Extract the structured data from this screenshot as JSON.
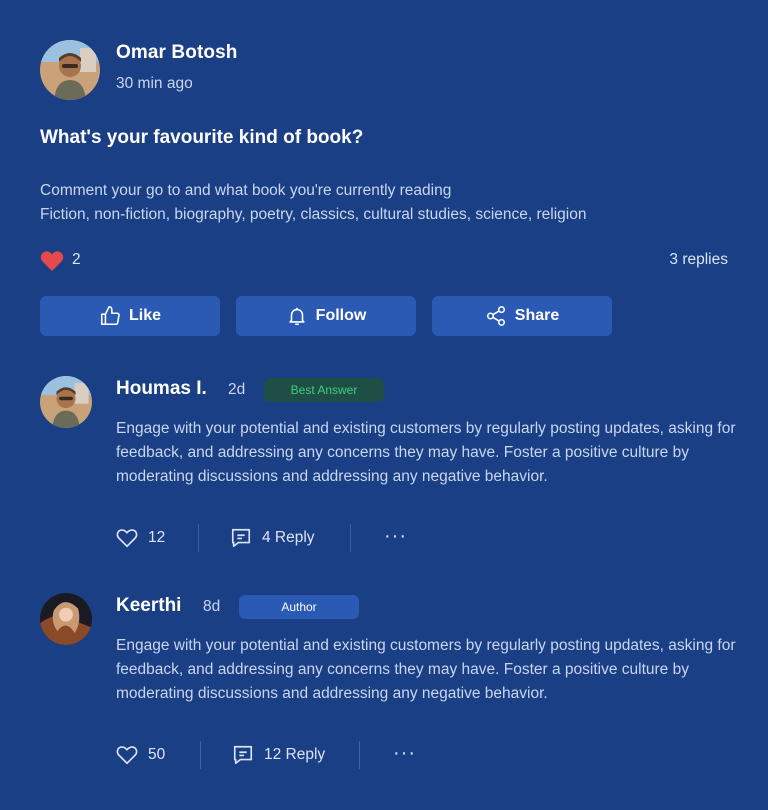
{
  "post": {
    "author": "Omar Botosh",
    "time": "30 min ago",
    "title": "What's your favourite kind of book?",
    "body_line1": "Comment your go to and what book you're currently reading",
    "body_line2": "Fiction, non-fiction, biography, poetry, classics, cultural studies, science, religion",
    "likes": "2",
    "replies": "3 replies",
    "like_color": "#e5484d"
  },
  "actions": {
    "like": "Like",
    "follow": "Follow",
    "share": "Share"
  },
  "comments": [
    {
      "name": "Houmas I.",
      "age": "2d",
      "badge": "Best Answer",
      "body": "Engage with your potential and existing customers by regularly posting updates, asking for feedback, and addressing any concerns they may have. Foster a positive culture by moderating discussions and addressing any negative behavior.",
      "likes": "12",
      "replies": "4 Reply",
      "more": "···"
    },
    {
      "name": "Keerthi",
      "age": "8d",
      "badge": "Author",
      "body": "Engage with your potential and existing customers by regularly posting updates, asking for feedback, and addressing any concerns they may have. Foster a positive culture by moderating discussions and addressing any negative behavior.",
      "likes": "50",
      "replies": "12 Reply",
      "more": "···"
    }
  ]
}
